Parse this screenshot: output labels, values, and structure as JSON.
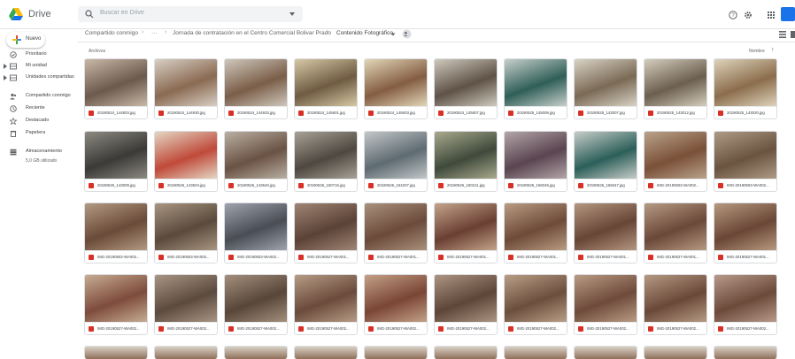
{
  "app": {
    "title": "Drive",
    "brand_colors": [
      "#fbbc04",
      "#34a853",
      "#1a73e8"
    ]
  },
  "search": {
    "placeholder": "Buscar en Drive",
    "icon": "search-icon"
  },
  "new_button": {
    "label": "Nuevo",
    "icon": "plus-icon"
  },
  "sidebar": {
    "items": [
      {
        "label": "Prioritario",
        "icon": "priority-icon"
      },
      {
        "label": "Mi unidad",
        "icon": "my-drive-icon"
      },
      {
        "label": "Unidades compartidas",
        "icon": "shared-drives-icon"
      },
      {
        "label": "Compartido conmigo",
        "icon": "shared-with-me-icon"
      },
      {
        "label": "Reciente",
        "icon": "clock-icon"
      },
      {
        "label": "Destacado",
        "icon": "star-icon"
      },
      {
        "label": "Papelera",
        "icon": "trash-icon"
      },
      {
        "label": "Almacenamiento",
        "icon": "storage-icon"
      }
    ],
    "storage_used": "5,0 GB utilizado"
  },
  "breadcrumb": {
    "items": [
      "Compartido conmigo",
      "···",
      "Jornada de contratación en el Centro Comercial Bolivar Prado",
      "Contenido Fotográfico"
    ]
  },
  "section": {
    "label": "Archivos",
    "sort": "Nombre",
    "sort_direction": "↑"
  },
  "files": [
    "20190524_144803.jpg",
    "20190524_144930.jpg",
    "20190524_144933.jpg",
    "20190524_145601.jpg",
    "20190524_145603.jpg",
    "20190524_145607.jpg",
    "20190525_145006.jpg",
    "20190525_143007.jpg",
    "20190525_143012.jpg",
    "20190525_143020.jpg",
    "20190526_143009.jpg",
    "20190526_143604.jpg",
    "20190526_143640.jpg",
    "20190526_150716.jpg",
    "20190526_154207.jpg",
    "20190526_150211.jpg",
    "20190526_156045.jpg",
    "20190526_156047.jpg",
    "IMG-20190503-WA002...",
    "IMG-20190503-WA002...",
    "IMG-20190503-WA002...",
    "IMG-20190503-WA002...",
    "IMG-20190503-WA002...",
    "IMG-20190527-WA001...",
    "IMG-20190527-WA001...",
    "IMG-20190527-WA001...",
    "IMG-20190527-WA001...",
    "IMG-20190527-WA001...",
    "IMG-20190527-WA001...",
    "IMG-20190527-WA001...",
    "IMG-20190527-WA002...",
    "IMG-20190527-WA002...",
    "IMG-20190527-WA002...",
    "IMG-20190527-WA002...",
    "IMG-20190527-WA002...",
    "IMG-20190527-WA002...",
    "IMG-20190527-WA002...",
    "IMG-20190527-WA002...",
    "IMG-20190527-WA002...",
    "IMG-20190527-WA002..."
  ]
}
